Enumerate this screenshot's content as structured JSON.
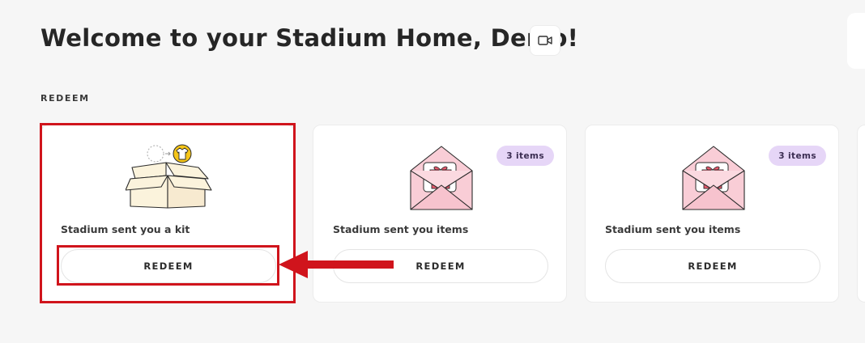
{
  "header": {
    "title": "Welcome to your Stadium Home, Demo!",
    "video_icon": "video-camera-icon"
  },
  "section": {
    "label": "REDEEM"
  },
  "cards": [
    {
      "title": "Stadium sent you a kit",
      "button_label": "REDEEM",
      "art": "open-box-with-tshirt"
    },
    {
      "title": "Stadium sent you items",
      "button_label": "REDEEM",
      "badge": "3 items",
      "art": "envelope-with-gift"
    },
    {
      "title": "Stadium sent you items",
      "button_label": "REDEEM",
      "badge": "3 items",
      "art": "envelope-with-gift"
    }
  ],
  "annotation": {
    "color": "#d0141c"
  },
  "colors": {
    "background": "#f6f6f6",
    "badge_bg": "#e6d6f7",
    "envelope_pink": "#f9cdd6",
    "gift_red": "#ec5a6e",
    "box_cream": "#fbf3dc",
    "tshirt_yellow": "#f5c518"
  }
}
